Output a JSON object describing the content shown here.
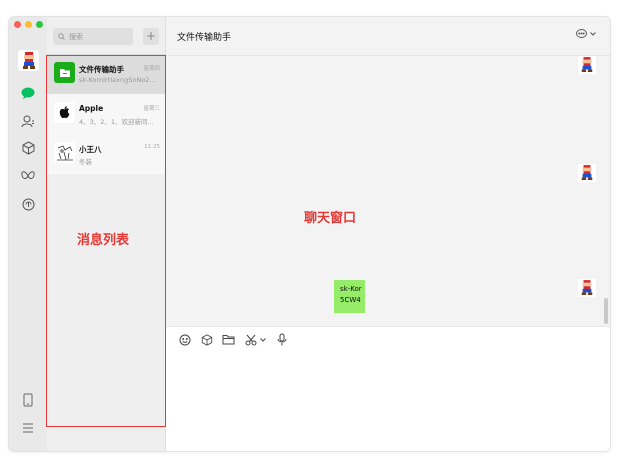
{
  "window": {
    "traffic_lights": [
      "close",
      "minimize",
      "zoom"
    ]
  },
  "sidebar": {
    "icons": [
      "avatar-mario",
      "chat-icon",
      "contacts-icon",
      "cube-icon",
      "butterfly-icon",
      "moments-icon"
    ],
    "bottom_icons": [
      "phone-icon",
      "menu-icon"
    ],
    "accent_color": "#07c160"
  },
  "chat_list": {
    "search_placeholder": "搜索",
    "add_label": "+",
    "items": [
      {
        "name": "文件传输助手",
        "time": "星期四",
        "preview": "sk-KornIrtIaxngSnNo2...",
        "avatar": "folder-icon"
      },
      {
        "name": "Apple",
        "time": "星期三",
        "preview": "4、3、2、1、欢迎新同...",
        "avatar": "apple-icon"
      },
      {
        "name": "小王八",
        "time": "11:25",
        "preview": "冬装",
        "avatar": "sketch-avatar"
      }
    ]
  },
  "annotations": {
    "list_label": "消息列表",
    "chat_label": "聊天窗口",
    "color": "#e53935"
  },
  "chat": {
    "title": "文件传输助手",
    "message_lines": [
      "sk-Kor",
      "5CW4"
    ],
    "toolbar": [
      "emoji-icon",
      "cube-icon",
      "folder-icon",
      "scissors-icon",
      "chevron-down-icon",
      "microphone-icon"
    ]
  }
}
